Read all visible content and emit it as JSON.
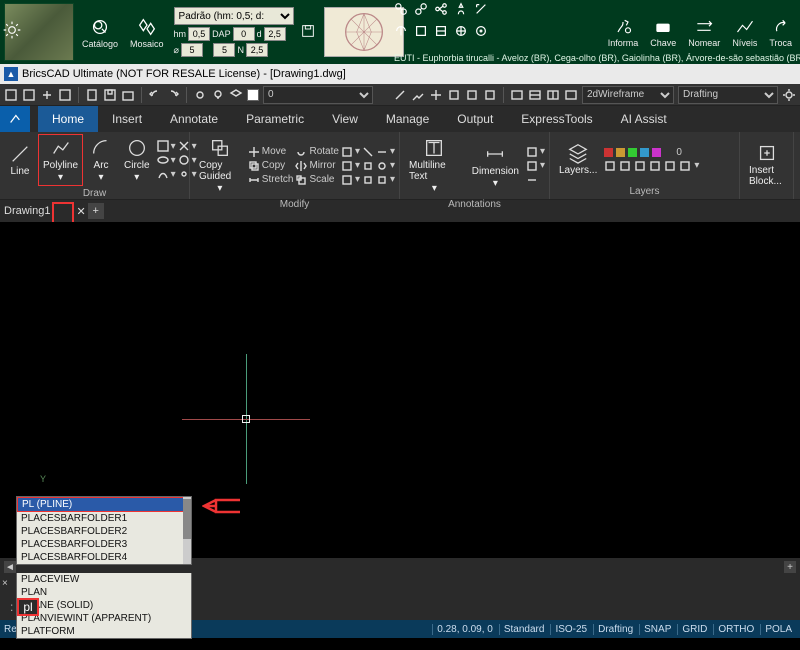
{
  "topbar": {
    "catalogo": "Catálogo",
    "mosaico": "Mosaico",
    "preset": "Padrão (hm: 0,5; d:",
    "fields": {
      "hm_label": "hm",
      "hm": "0,5",
      "h_label": "⌀",
      "h": "5",
      "dap_label": "DAP",
      "dap": "",
      "zero1": "0",
      "zero2": "5",
      "d_label": "d",
      "d1": "",
      "d2": "2,5",
      "d3": "2,5",
      "n_label": "N",
      "n": ""
    },
    "informa": "Informa",
    "chave": "Chave",
    "nomear": "Nomear",
    "niveis": "Níveis",
    "troca": "Troca",
    "euti": "EUTI - Euphorbia tirucalli - Aveloz (BR), Cega-olho (BR), Gaiolinha (BR), Árvore-de-são sebastião (BR), E"
  },
  "title": "BricsCAD Ultimate (NOT FOR RESALE License) - [Drawing1.dwg]",
  "quick": {
    "zero": "0",
    "visual": "2dWireframe",
    "mode": "Drafting"
  },
  "tabs": [
    "Home",
    "Insert",
    "Annotate",
    "Parametric",
    "View",
    "Manage",
    "Output",
    "ExpressTools",
    "AI Assist"
  ],
  "ribbon": {
    "draw": {
      "label": "Draw",
      "line": "Line",
      "polyline": "Polyline",
      "arc": "Arc",
      "circle": "Circle"
    },
    "modify": {
      "label": "Modify",
      "copy": "Copy Guided",
      "move": "Move",
      "copy2": "Copy",
      "stretch": "Stretch",
      "rotate": "Rotate",
      "mirror": "Mirror",
      "scale": "Scale"
    },
    "annot": {
      "label": "Annotations",
      "mtext": "Multiline Text",
      "dim": "Dimension"
    },
    "layers": {
      "label": "Layers",
      "btn": "Layers..."
    },
    "block": {
      "label": "",
      "btn": "Insert Block..."
    }
  },
  "dwgtab": "Drawing1",
  "autocomplete": {
    "selected": "PL (PLINE)",
    "items": [
      "PLACESBARFOLDER1",
      "PLACESBARFOLDER2",
      "PLACESBARFOLDER3",
      "PLACESBARFOLDER4",
      "PLACEVIEW",
      "PLAN",
      "PLANE (SOLID)",
      "PLANVIEWINT (APPARENT)",
      "PLATFORM"
    ]
  },
  "cmd": {
    "prompt": ":",
    "input": "pl"
  },
  "status": {
    "ready": "Ready",
    "coords": "0.28, 0.09, 0",
    "std": "Standard",
    "iso": "ISO-25",
    "draft": "Drafting",
    "toggles": [
      "SNAP",
      "GRID",
      "ORTHO",
      "POLA"
    ]
  },
  "axis": {
    "y": "Y"
  }
}
